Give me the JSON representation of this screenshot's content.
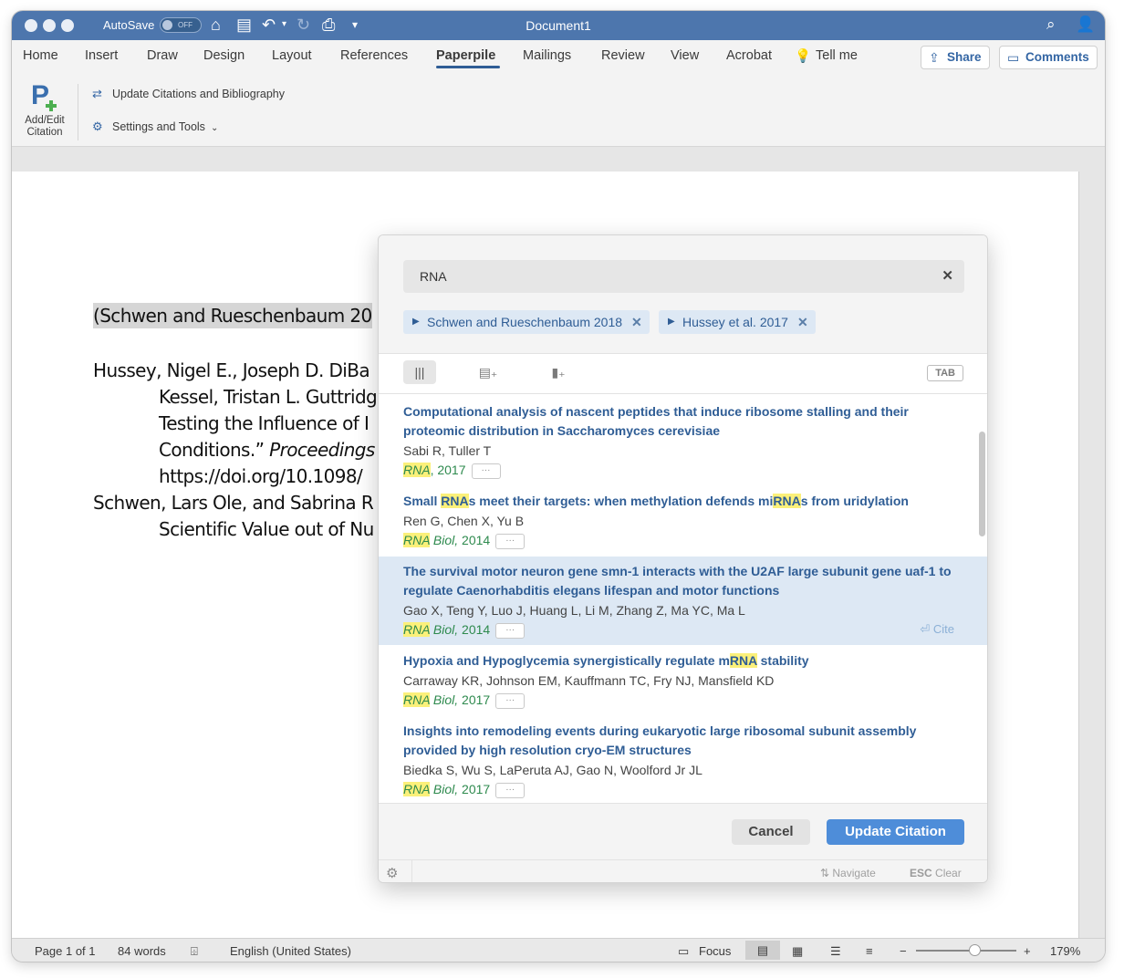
{
  "titlebar": {
    "autosave_label": "AutoSave",
    "autosave_state": "OFF",
    "document_title": "Document1",
    "icons": [
      "home-icon",
      "save-icon",
      "undo-icon",
      "redo-icon",
      "print-icon",
      "customize-icon",
      "search-icon",
      "account-icon"
    ]
  },
  "ribbon": {
    "tabs": [
      "Home",
      "Insert",
      "Draw",
      "Design",
      "Layout",
      "References",
      "Paperpile",
      "Mailings",
      "Review",
      "View",
      "Acrobat",
      "Tell me"
    ],
    "active_tab": "Paperpile",
    "share_label": "Share",
    "comments_label": "Comments",
    "add_edit_label": "Add/Edit Citation",
    "update_citations_label": "Update Citations and Bibliography",
    "settings_label": "Settings and Tools"
  },
  "document": {
    "citation": "(Schwen and Rueschenbaum 20",
    "lines": [
      "Hussey, Nigel E., Joseph D. DiBa",
      "Kessel, Tristan L. Guttridg",
      "Testing the Influence of I",
      "Conditions.” ",
      "https://doi.org/10.1098/",
      "Schwen, Lars Ole, and Sabrina R",
      "Scientific Value out of Nu"
    ],
    "line4_italic": "Proceedings"
  },
  "dialog": {
    "search_value": "RNA",
    "chips": [
      {
        "label": "Schwen and Rueschenbaum 2018"
      },
      {
        "label": "Hussey et al. 2017"
      }
    ],
    "tab_key": "TAB",
    "results": [
      {
        "title_parts": [
          "Computational analysis of nascent peptides that induce ribosome stalling and their proteomic distribution in Saccharomyces cerevisiae"
        ],
        "authors": "Sabi R, Tuller T",
        "journal_mark": "RNA",
        "journal_rest": ", 2017"
      },
      {
        "title_parts": [
          "Small ",
          "RNA",
          "s meet their targets: when methylation defends mi",
          "RNA",
          "s from uridylation"
        ],
        "authors": "Ren G, Chen X, Yu B",
        "journal_mark": "RNA",
        "journal_italic": " Biol,",
        "journal_rest": " 2014"
      },
      {
        "title_parts": [
          "The survival motor neuron gene smn-1 interacts with the U2AF large subunit gene uaf-1 to regulate Caenorhabditis elegans lifespan and motor functions"
        ],
        "authors": "Gao X, Teng Y, Luo J, Huang L, Li M, Zhang Z, Ma YC, Ma L",
        "journal_mark": "RNA",
        "journal_italic": " Biol,",
        "journal_rest": " 2014",
        "cite_hint": "Cite"
      },
      {
        "title_parts": [
          "Hypoxia and Hypoglycemia synergistically regulate m",
          "RNA",
          " stability"
        ],
        "authors": "Carraway KR, Johnson EM, Kauffmann TC, Fry NJ, Mansfield KD",
        "journal_mark": "RNA",
        "journal_italic": " Biol,",
        "journal_rest": " 2017"
      },
      {
        "title_parts": [
          "Insights into remodeling events during eukaryotic large ribosomal subunit assembly provided by high resolution cryo-EM structures"
        ],
        "authors": "Biedka S, Wu S, LaPeruta AJ, Gao N, Woolford Jr JL",
        "journal_mark": "RNA",
        "journal_italic": " Biol,",
        "journal_rest": " 2017"
      }
    ],
    "more_label": "···",
    "cancel_label": "Cancel",
    "update_label": "Update Citation",
    "navigate_hint": "Navigate",
    "esc_key": "ESC",
    "clear_hint": "Clear"
  },
  "statusbar": {
    "page": "Page 1 of 1",
    "words": "84 words",
    "language": "English (United States)",
    "focus": "Focus",
    "zoom": "179%"
  },
  "colors": {
    "titlebar": "#4d76ad",
    "accent_blue": "#2f5d95",
    "update_button": "#4e8dd9",
    "highlight_row": "#dde8f4",
    "journal_green": "#2e8a4e",
    "match_yellow": "#fbf07a"
  }
}
